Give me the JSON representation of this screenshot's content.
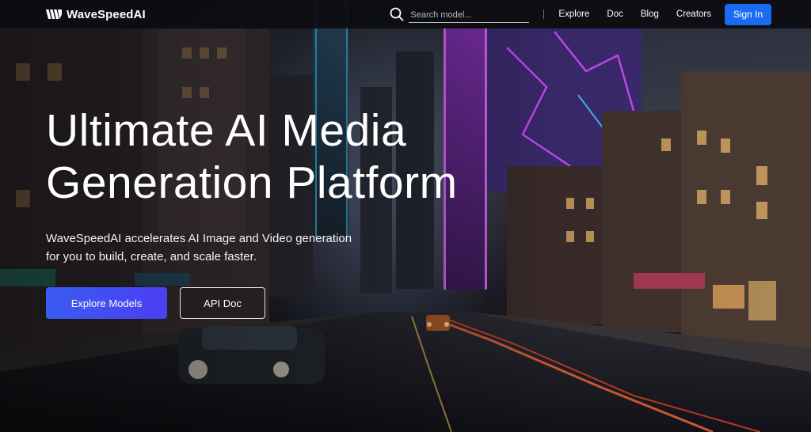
{
  "header": {
    "brand": "WaveSpeedAI",
    "search": {
      "placeholder": "Search model...",
      "value": ""
    },
    "nav": [
      {
        "label": "Explore"
      },
      {
        "label": "Doc"
      },
      {
        "label": "Blog"
      },
      {
        "label": "Creators"
      }
    ],
    "signin_label": "Sign In"
  },
  "hero": {
    "title_line1": "Ultimate AI Media",
    "title_line2": "Generation Platform",
    "subtitle_line1": "WaveSpeedAI accelerates AI Image and Video generation",
    "subtitle_line2": "for you to build, create, and scale faster.",
    "primary_label": "Explore Models",
    "secondary_label": "API Doc"
  },
  "colors": {
    "accent": "#1a6af2",
    "primary_gradient_start": "#3a5cf0",
    "primary_gradient_end": "#4b3ff2",
    "neon_pink": "#d94cff",
    "neon_cyan": "#4fd9ff"
  },
  "icons": {
    "logo": "wavespeed-logo-icon",
    "search": "search-icon"
  }
}
